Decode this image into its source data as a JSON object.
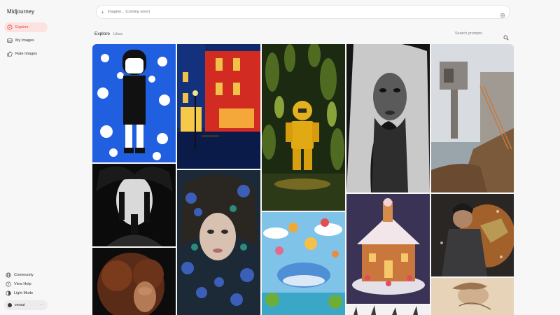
{
  "app": {
    "brand": "Midjourney"
  },
  "sidebar": {
    "nav": [
      {
        "label": "Explore",
        "icon": "compass-icon",
        "active": true
      },
      {
        "label": "My Images",
        "icon": "images-icon",
        "active": false
      },
      {
        "label": "Rate Images",
        "icon": "thumbs-up-icon",
        "active": false
      }
    ],
    "footer": [
      {
        "label": "Community",
        "icon": "globe-icon"
      },
      {
        "label": "View Help",
        "icon": "help-icon"
      },
      {
        "label": "Light Mode",
        "icon": "sun-icon"
      }
    ],
    "user": {
      "name": "vexxat",
      "more": "···"
    }
  },
  "imagine": {
    "placeholder": "Imagine... (coming soon)",
    "plus": "+"
  },
  "explore": {
    "title": "Explore",
    "tab_likes": "Likes",
    "search_placeholder": "Search prompts"
  },
  "gallery": {
    "items": [
      {
        "name": "blue-cat-girl-illustration",
        "subject": "cartoon girl with cats, blue"
      },
      {
        "name": "night-street-facade",
        "subject": "red building at night"
      },
      {
        "name": "lego-figure-garden",
        "subject": "yellow lego figure in plants"
      },
      {
        "name": "bw-woman-portrait",
        "subject": "black and white woman portrait"
      },
      {
        "name": "concrete-house-coast",
        "subject": "concrete house by the sea"
      },
      {
        "name": "dark-dripping-face",
        "subject": "black and white dripping face"
      },
      {
        "name": "floral-girl-portrait",
        "subject": "girl with blue flowers"
      },
      {
        "name": "whale-balloons-fantasy",
        "subject": "whale with hot air balloons"
      },
      {
        "name": "gingerbread-house",
        "subject": "gingerbread house"
      },
      {
        "name": "armored-hero",
        "subject": "man with metal gauntlet"
      },
      {
        "name": "curly-hair-woman",
        "subject": "woman with curly hair"
      },
      {
        "name": "sepia-sketch",
        "subject": "sepia figure sketch"
      },
      {
        "name": "white-spikes",
        "subject": "white sculpture"
      }
    ]
  },
  "colors": {
    "accent": "#e0453d",
    "accent_bg": "#fde2e2"
  }
}
